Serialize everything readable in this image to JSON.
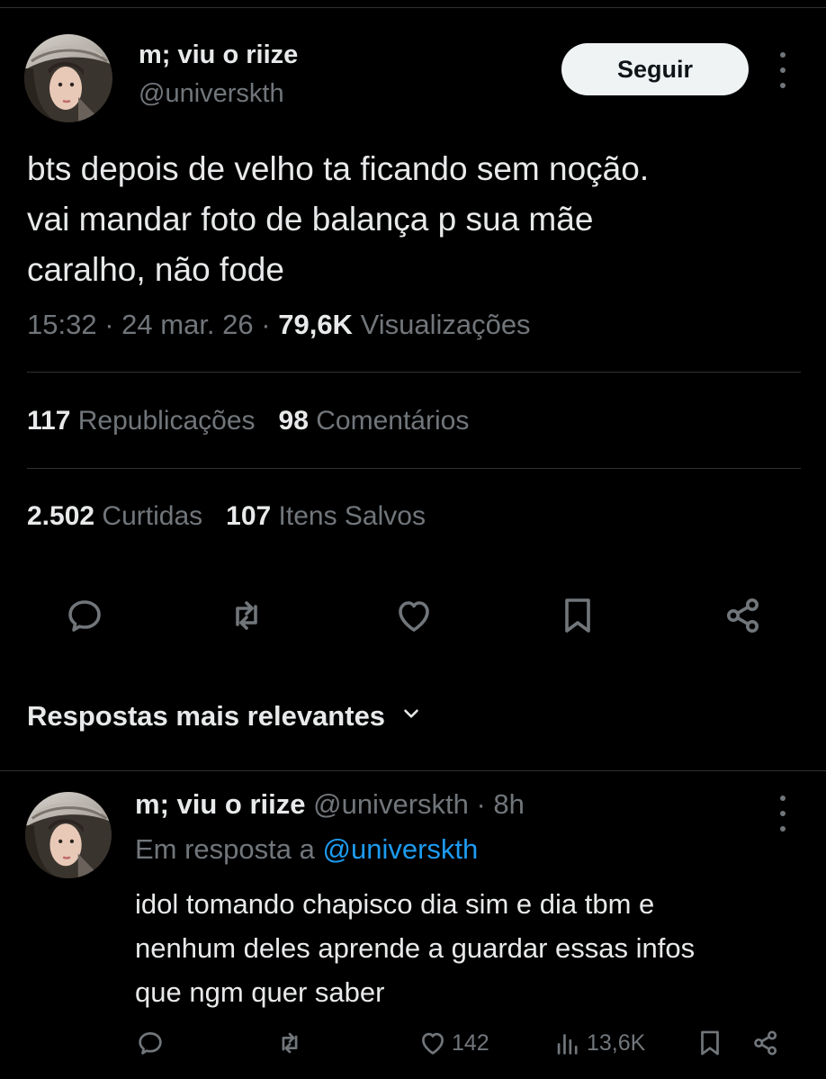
{
  "tweet": {
    "display_name": "m; viu o riize",
    "handle": "@universkth",
    "follow_label": "Seguir",
    "text_lines": [
      "bts depois de velho ta ficando sem noção.",
      "vai mandar foto de balança p sua mãe",
      "caralho, não fode"
    ],
    "time": "15:32",
    "date": "24 mar. 26",
    "views_count": "79,6K",
    "views_label": "Visualizações",
    "separator": "·"
  },
  "stats": {
    "reposts_count": "117",
    "reposts_label": "Republicações",
    "comments_count": "98",
    "comments_label": "Comentários",
    "likes_count": "2.502",
    "likes_label": "Curtidas",
    "bookmarks_count": "107",
    "bookmarks_label": "Itens Salvos"
  },
  "actions": {
    "icons": [
      "comment-icon",
      "repost-icon",
      "heart-icon",
      "bookmark-icon",
      "share-icon"
    ]
  },
  "replies_section": {
    "title": "Respostas mais relevantes"
  },
  "reply": {
    "display_name": "m; viu o riize",
    "handle": "@universkth",
    "time_ago": "· 8h",
    "reply_to_prefix": "Em resposta a",
    "reply_to_handle": "@universkth",
    "text_lines": [
      "idol tomando chapisco dia sim e dia tbm e",
      "nenhum deles aprende a guardar essas infos",
      "que ngm quer saber"
    ],
    "likes": "142",
    "views": "13,6K"
  },
  "colors": {
    "background": "#000000",
    "text": "#e7e9ea",
    "muted": "#71767b",
    "link": "#1d9bf0",
    "divider": "#2f3336",
    "button_bg": "#eff3f4"
  }
}
